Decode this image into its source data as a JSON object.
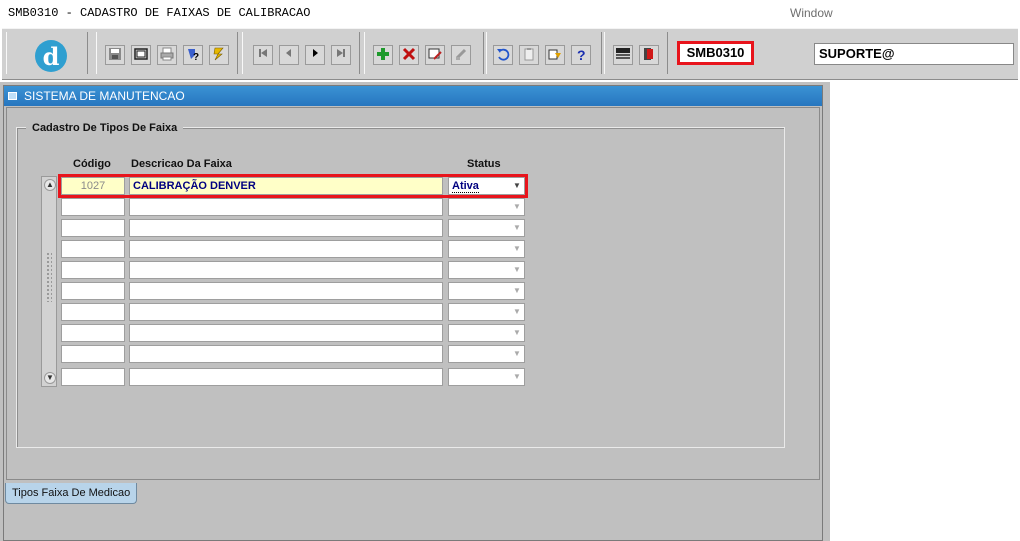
{
  "menubar": {
    "title": "SMB0310 - CADASTRO DE FAIXAS DE CALIBRACAO",
    "window_menu": "Window"
  },
  "toolbar": {
    "logo_letter": "d",
    "form_code": "SMB0310",
    "user": "SUPORTE@",
    "icons": [
      "save-icon",
      "print-preview-icon",
      "print-icon",
      "query-icon",
      "execute-query-icon",
      "first-record-icon",
      "previous-record-icon",
      "next-record-icon",
      "last-record-icon",
      "insert-record-icon",
      "delete-record-icon",
      "edit-record-icon",
      "clear-icon",
      "undo-icon",
      "paste-icon",
      "list-values-icon",
      "help-icon",
      "menu-icon",
      "exit-icon"
    ]
  },
  "window": {
    "title": "SISTEMA DE MANUTENCAO"
  },
  "frame": {
    "title": "Cadastro De Tipos De Faixa"
  },
  "columns": {
    "codigo": "Código",
    "descricao": "Descricao Da Faixa",
    "status": "Status"
  },
  "rows": [
    {
      "codigo": "1027",
      "descricao": "CALIBRAÇÃO DENVER",
      "status": "Ativa"
    },
    {
      "codigo": "",
      "descricao": "",
      "status": ""
    },
    {
      "codigo": "",
      "descricao": "",
      "status": ""
    },
    {
      "codigo": "",
      "descricao": "",
      "status": ""
    },
    {
      "codigo": "",
      "descricao": "",
      "status": ""
    },
    {
      "codigo": "",
      "descricao": "",
      "status": ""
    },
    {
      "codigo": "",
      "descricao": "",
      "status": ""
    },
    {
      "codigo": "",
      "descricao": "",
      "status": ""
    },
    {
      "codigo": "",
      "descricao": "",
      "status": ""
    },
    {
      "codigo": "",
      "descricao": "",
      "status": ""
    }
  ],
  "tab": {
    "label": "Tipos Faixa De Medicao"
  },
  "colors": {
    "title_bar": "#2f86cc",
    "highlight": "#e8141c",
    "active_field": "#ffffc8"
  }
}
